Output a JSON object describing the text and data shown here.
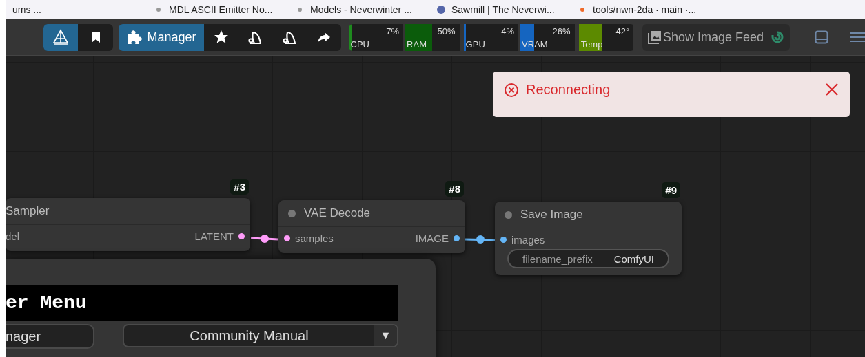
{
  "browser_tabs": [
    {
      "title": "ums ..."
    },
    {
      "title": "MDL ASCII Emitter No..."
    },
    {
      "title": "Models - Neverwinter ..."
    },
    {
      "title": "Sawmill | The Neverwi..."
    },
    {
      "title": "tools/nwn-2da · main ·..."
    }
  ],
  "toolbar": {
    "manager_label": "Manager",
    "monitors": [
      {
        "label": "CPU",
        "reading": "7%",
        "level": 0.07,
        "color": "#1e8a1e"
      },
      {
        "label": "RAM",
        "reading": "50%",
        "level": 0.5,
        "color": "#0b5c0b"
      },
      {
        "label": "GPU",
        "reading": "4%",
        "level": 0.04,
        "color": "#1565c0"
      },
      {
        "label": "VRAM",
        "reading": "26%",
        "level": 0.26,
        "color": "#1565c0"
      },
      {
        "label": "Temp",
        "reading": "42°",
        "level": 0.42,
        "color": "#5c8a00"
      }
    ],
    "image_feed_label": "Show Image Feed"
  },
  "toast": {
    "message": "Reconnecting"
  },
  "nodes": [
    {
      "badge": "#3",
      "title": "Sampler",
      "inputs": [
        {
          "name": "del"
        }
      ],
      "outputs": [
        {
          "name": "LATENT",
          "color": "#ff9cf9"
        }
      ]
    },
    {
      "badge": "#8",
      "title": "VAE Decode",
      "inputs": [
        {
          "name": "samples",
          "color": "#ff9cf9"
        }
      ],
      "outputs": [
        {
          "name": "IMAGE",
          "color": "#64b5f6"
        }
      ]
    },
    {
      "badge": "#9",
      "title": "Save Image",
      "inputs": [
        {
          "name": "images",
          "color": "#64b5f6"
        }
      ],
      "widgets": [
        {
          "name": "filename_prefix",
          "value": "ComfyUI"
        }
      ]
    }
  ],
  "menu": {
    "title": "er Menu",
    "buttons": [
      {
        "label": "nager"
      }
    ],
    "dropdowns": [
      {
        "value": "Community Manual",
        "caret": "▼"
      }
    ]
  }
}
